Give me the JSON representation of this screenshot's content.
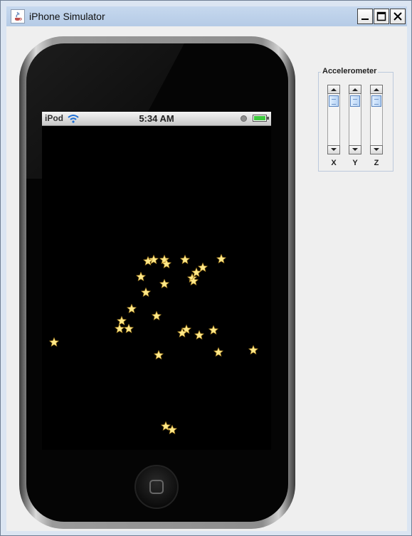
{
  "window": {
    "title": "iPhone Simulator",
    "icon": "java-cup-icon",
    "controls": [
      "minimize-icon",
      "maximize-icon",
      "close-icon"
    ]
  },
  "status_bar": {
    "carrier": "iPod",
    "time": "5:34 AM",
    "wifi_icon": "wifi-icon",
    "lock_icon": "lock-icon",
    "battery_level": 1.0,
    "battery_color": "#3ec93e"
  },
  "accelerometer": {
    "title": "Accelerometer",
    "axes": [
      {
        "label": "X",
        "value": 0
      },
      {
        "label": "Y",
        "value": 0
      },
      {
        "label": "Z",
        "value": 0
      }
    ]
  },
  "stars": {
    "count": 29,
    "color": "#ffe98a",
    "icon": "star-icon"
  }
}
